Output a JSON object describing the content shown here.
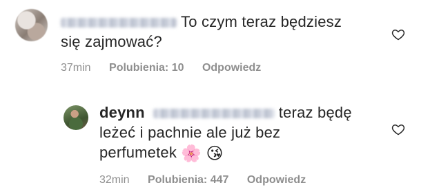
{
  "comments": [
    {
      "username": "",
      "text": "To czym teraz będziesz się zajmować?",
      "time": "37min",
      "likes": "Polubienia: 10",
      "reply": "Odpowiedz"
    },
    {
      "username": "deynn",
      "text_line1": "teraz będę",
      "text_line2": "leżeć i pachnie ale już bez",
      "text_line3": "perfumetek",
      "emojis": [
        "🌸",
        "😘"
      ],
      "time": "32min",
      "likes": "Polubienia: 447",
      "reply": "Odpowiedz"
    }
  ],
  "icons": {
    "like": "heart-outline-icon"
  }
}
